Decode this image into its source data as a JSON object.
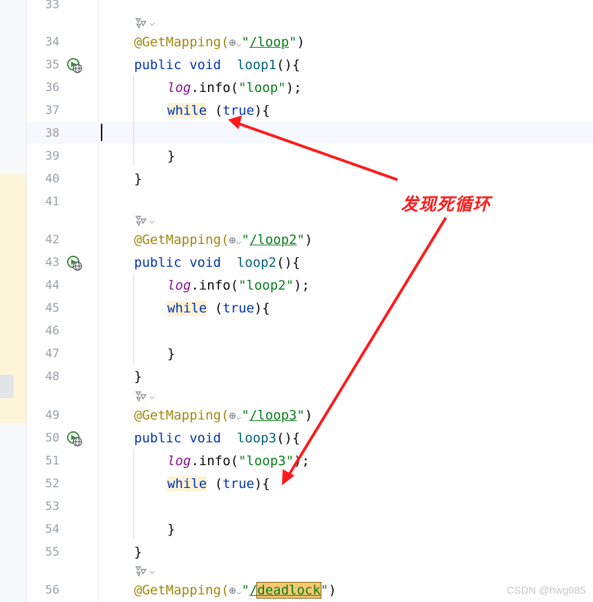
{
  "editor": {
    "line_numbers": [
      "33",
      "34",
      "35",
      "36",
      "37",
      "38",
      "39",
      "40",
      "41",
      "42",
      "43",
      "44",
      "45",
      "46",
      "47",
      "48",
      "49",
      "50",
      "51",
      "52",
      "53",
      "54",
      "55",
      "56"
    ],
    "code_lines": [
      {
        "annotation": "@GetMapping(",
        "path": "/loop",
        "close": ")"
      },
      {
        "kw1": "public",
        "kw2": "void",
        "name": "loop1",
        "tail": "(){"
      },
      {
        "field": "log",
        "call": ".info(",
        "str": "\"loop\"",
        "tail": ");"
      },
      {
        "kw": "while",
        "mid": " (",
        "kw_true": "true",
        "tail": "){"
      },
      {
        "text": "}"
      },
      {
        "text": "}"
      },
      {
        "annotation": "@GetMapping(",
        "path": "/loop2",
        "close": ")"
      },
      {
        "kw1": "public",
        "kw2": "void",
        "name": "loop2",
        "tail": "(){"
      },
      {
        "field": "log",
        "call": ".info(",
        "str": "\"loop2\"",
        "tail": ");"
      },
      {
        "kw": "while",
        "mid": " (",
        "kw_true": "true",
        "tail": "){"
      },
      {
        "text": "}"
      },
      {
        "text": "}"
      },
      {
        "annotation": "@GetMapping(",
        "path": "/loop3",
        "close": ")"
      },
      {
        "kw1": "public",
        "kw2": "void",
        "name": "loop3",
        "tail": "(){"
      },
      {
        "field": "log",
        "call": ".info(",
        "str": "\"loop3\"",
        "tail": ");"
      },
      {
        "kw": "while",
        "mid": " (",
        "kw_true": "true",
        "tail": "){"
      },
      {
        "text": "}"
      },
      {
        "text": "}"
      },
      {
        "annotation": "@GetMapping(",
        "path": "deadlock",
        "close": ")"
      }
    ],
    "quote": "\"",
    "slash": "/"
  },
  "annotation_note": "发现死循环",
  "watermark": "CSDN @hwg985",
  "colors": {
    "arrow": "#ff1a1a",
    "keyword": "#0033b3",
    "string": "#067d17",
    "annotation": "#9e880d"
  },
  "icons": [
    "endpoint-hint-icon",
    "globe-icon",
    "chevron-down-icon",
    "run-web-endpoint-icon"
  ]
}
